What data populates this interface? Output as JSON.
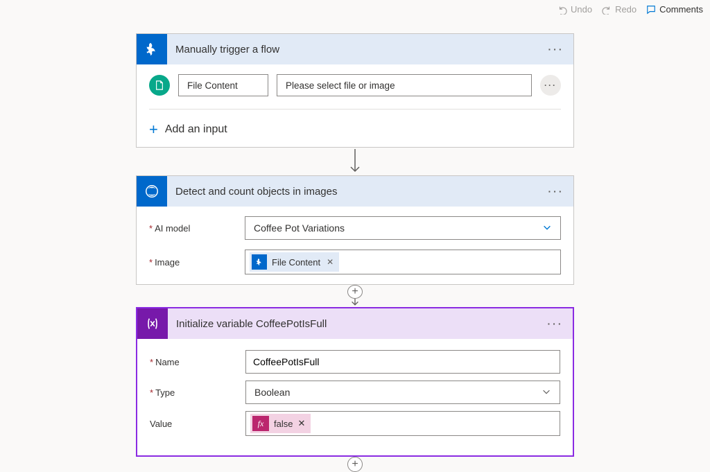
{
  "toolbar": {
    "undo": "Undo",
    "redo": "Redo",
    "comments": "Comments"
  },
  "trigger_card": {
    "title": "Manually trigger a flow",
    "file_label": "File Content",
    "file_placeholder": "Please select file or image",
    "add_input": "Add an input"
  },
  "detect_card": {
    "title": "Detect and count objects in images",
    "fields": {
      "model_label": "AI model",
      "model_value": "Coffee Pot Variations",
      "image_label": "Image",
      "image_token": "File Content"
    }
  },
  "var_card": {
    "title": "Initialize variable CoffeePotIsFull",
    "fields": {
      "name_label": "Name",
      "name_value": "CoffeePotIsFull",
      "type_label": "Type",
      "type_value": "Boolean",
      "value_label": "Value",
      "value_token": "false",
      "fx_label": "fx"
    }
  }
}
